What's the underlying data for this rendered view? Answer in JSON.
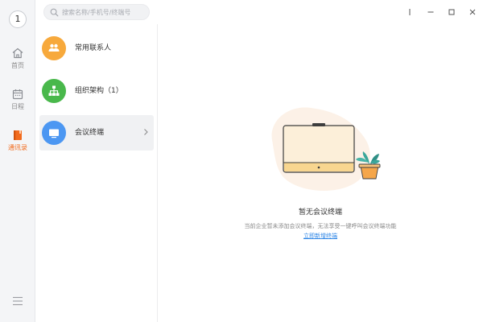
{
  "user": {
    "avatar_text": "1"
  },
  "nav": {
    "items": [
      {
        "label": "首页",
        "icon": "home-icon"
      },
      {
        "label": "日程",
        "icon": "calendar-icon"
      },
      {
        "label": "通讯录",
        "icon": "contacts-book-icon",
        "active": true
      }
    ]
  },
  "search": {
    "placeholder": "搜索名称/手机号/终端号"
  },
  "contacts": {
    "items": [
      {
        "label": "常用联系人",
        "icon": "frequent-contacts-icon",
        "color": "#f7a93c"
      },
      {
        "label": "组织架构（1）",
        "icon": "org-chart-icon",
        "color": "#49b84b"
      },
      {
        "label": "会议终端",
        "icon": "meeting-terminal-icon",
        "color": "#4c97f2",
        "selected": true
      }
    ]
  },
  "empty_state": {
    "title": "暂无会议终端",
    "description": "当前企业暂未添加会议终端，无法享受一键呼叫会议终端功能",
    "link": "立即新增终端"
  },
  "colors": {
    "accent": "#f26b1d",
    "link": "#2e86e6"
  }
}
